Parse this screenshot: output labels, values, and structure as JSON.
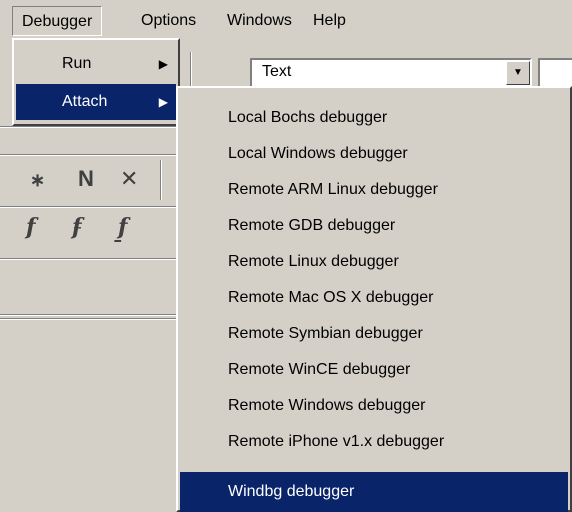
{
  "menubar": {
    "items": [
      {
        "label": "Debugger",
        "open": true
      },
      {
        "label": "Options"
      },
      {
        "label": "Windows"
      },
      {
        "label": "Help"
      }
    ]
  },
  "toolbar": {
    "combo_text": "Text",
    "row1_glyphs": [
      "∗",
      "N",
      "✕"
    ],
    "row2_glyphs": [
      "f",
      "f̵",
      "f̱"
    ]
  },
  "debugger_menu": {
    "items": [
      {
        "label": "Run",
        "has_submenu": true
      },
      {
        "label": "Attach",
        "has_submenu": true,
        "selected": true
      }
    ],
    "arrow": "▶"
  },
  "attach_submenu": {
    "items": [
      {
        "label": "Local Bochs debugger"
      },
      {
        "label": "Local Windows debugger"
      },
      {
        "label": "Remote ARM Linux debugger"
      },
      {
        "label": "Remote GDB debugger"
      },
      {
        "label": "Remote Linux debugger"
      },
      {
        "label": "Remote Mac OS X debugger"
      },
      {
        "label": "Remote Symbian debugger"
      },
      {
        "label": "Remote WinCE debugger"
      },
      {
        "label": "Remote Windows debugger"
      },
      {
        "label": "Remote iPhone v1.x debugger"
      },
      {
        "label": "Windbg debugger",
        "selected": true
      }
    ]
  },
  "colors": {
    "face": "#d4d0c8",
    "highlight": "#0a246a",
    "highlight_text": "#ffffff"
  }
}
